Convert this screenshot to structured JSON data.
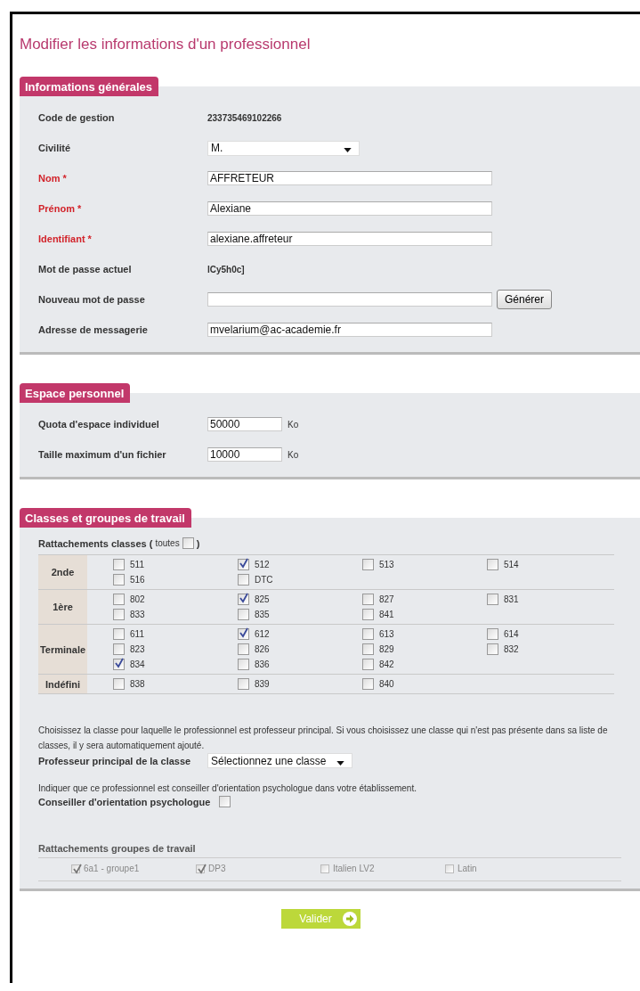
{
  "title": "Modifier les informations d'un professionnel",
  "general": {
    "heading": "Informations générales",
    "fields": [
      {
        "kind": "value",
        "label": "Code de gestion",
        "required": false,
        "value": "233735469102266"
      },
      {
        "kind": "select",
        "label": "Civilité",
        "required": false,
        "value": "M."
      },
      {
        "kind": "input",
        "label": "Nom *",
        "required": true,
        "value": "AFFRETEUR"
      },
      {
        "kind": "input",
        "label": "Prénom *",
        "required": true,
        "value": "Alexiane"
      },
      {
        "kind": "input",
        "label": "Identifiant *",
        "required": true,
        "value": "alexiane.affreteur"
      },
      {
        "kind": "value",
        "label": "Mot de passe actuel",
        "required": false,
        "value": "lCy5h0c]"
      },
      {
        "kind": "input",
        "label": "Nouveau mot de passe",
        "required": false,
        "button": "Générer"
      },
      {
        "kind": "input",
        "label": "Adresse de messagerie",
        "required": false,
        "value": "mvelarium@ac-academie.fr"
      }
    ]
  },
  "personal": {
    "heading": "Espace personnel",
    "fields": [
      {
        "label": "Quota d'espace individuel",
        "value": "50000",
        "unit": "Ko"
      },
      {
        "label": "Taille maximum d'un fichier",
        "value": "10000",
        "unit": "Ko"
      }
    ]
  },
  "classes": {
    "heading": "Classes et groupes de travail",
    "attach_label": "Rattachements classes (",
    "all_label": "toutes",
    "all_checked": false,
    "attach_close": ")",
    "rows": [
      {
        "label": "2nde",
        "items": [
          {
            "label": "511",
            "checked": false
          },
          {
            "label": "512",
            "checked": true
          },
          {
            "label": "513",
            "checked": false
          },
          {
            "label": "514",
            "checked": false
          },
          {
            "label": "516",
            "checked": false
          },
          {
            "label": "DTC",
            "checked": false
          }
        ]
      },
      {
        "label": "1ère",
        "items": [
          {
            "label": "802",
            "checked": false
          },
          {
            "label": "825",
            "checked": true
          },
          {
            "label": "827",
            "checked": false
          },
          {
            "label": "831",
            "checked": false
          },
          {
            "label": "833",
            "checked": false
          },
          {
            "label": "835",
            "checked": false
          },
          {
            "label": "841",
            "checked": false
          }
        ]
      },
      {
        "label": "Terminale",
        "items": [
          {
            "label": "611",
            "checked": false
          },
          {
            "label": "612",
            "checked": true
          },
          {
            "label": "613",
            "checked": false
          },
          {
            "label": "614",
            "checked": false
          },
          {
            "label": "823",
            "checked": false
          },
          {
            "label": "826",
            "checked": false
          },
          {
            "label": "829",
            "checked": false
          },
          {
            "label": "832",
            "checked": false
          },
          {
            "label": "834",
            "checked": true
          },
          {
            "label": "836",
            "checked": false
          },
          {
            "label": "842",
            "checked": false
          }
        ]
      },
      {
        "label": "Indéfini",
        "items": [
          {
            "label": "838",
            "checked": false
          },
          {
            "label": "839",
            "checked": false
          },
          {
            "label": "840",
            "checked": false
          }
        ]
      }
    ],
    "principal_help": "Choisissez la classe pour laquelle le professionnel est professeur principal. Si vous choisissez une classe qui n'est pas présente dans sa liste de classes, il y sera automatiquement ajouté.",
    "principal_label": "Professeur principal de la classe",
    "principal_select": "Sélectionnez une classe",
    "counselor_help": "Indiquer que ce professionnel est conseiller d'orientation psychologue dans votre établissement.",
    "counselor_label": "Conseiller d'orientation psychologue",
    "counselor_checked": false,
    "groups_label": "Rattachements groupes de travail",
    "groups": [
      {
        "label": "6a1 - groupe1",
        "checked": true,
        "disabled": true
      },
      {
        "label": "DP3",
        "checked": true,
        "disabled": true
      },
      {
        "label": "Italien LV2",
        "checked": false,
        "disabled": true
      },
      {
        "label": "Latin",
        "checked": false,
        "disabled": true
      }
    ]
  },
  "submit": "Valider"
}
